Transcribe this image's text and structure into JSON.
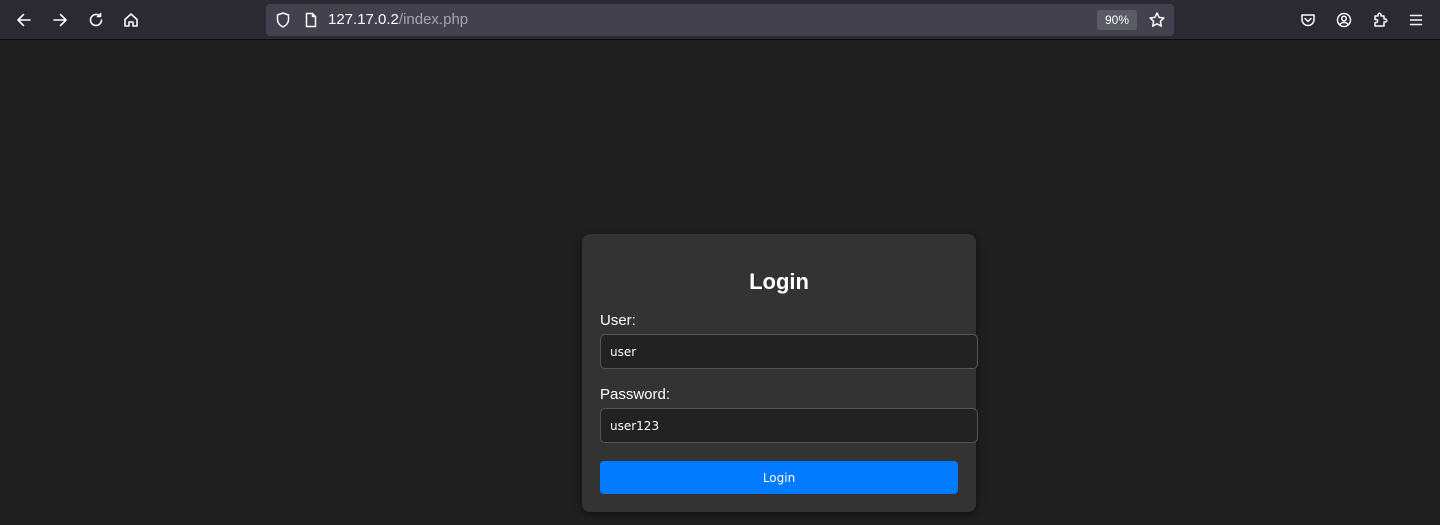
{
  "browser": {
    "url_host": "127.17.0.2",
    "url_path": "/index.php",
    "zoom": "90%"
  },
  "icons": {
    "back": "arrow-left",
    "forward": "arrow-right",
    "reload": "reload",
    "home": "home",
    "tracking": "shield",
    "page": "page",
    "bookmark": "star",
    "pocket": "pocket",
    "account": "account",
    "extensions": "puzzle",
    "menu": "hamburger"
  },
  "login": {
    "title": "Login",
    "user_label": "User:",
    "user_value": "user",
    "password_label": "Password:",
    "password_value": "user123",
    "button_label": "Login",
    "accent_color": "#007bff"
  }
}
